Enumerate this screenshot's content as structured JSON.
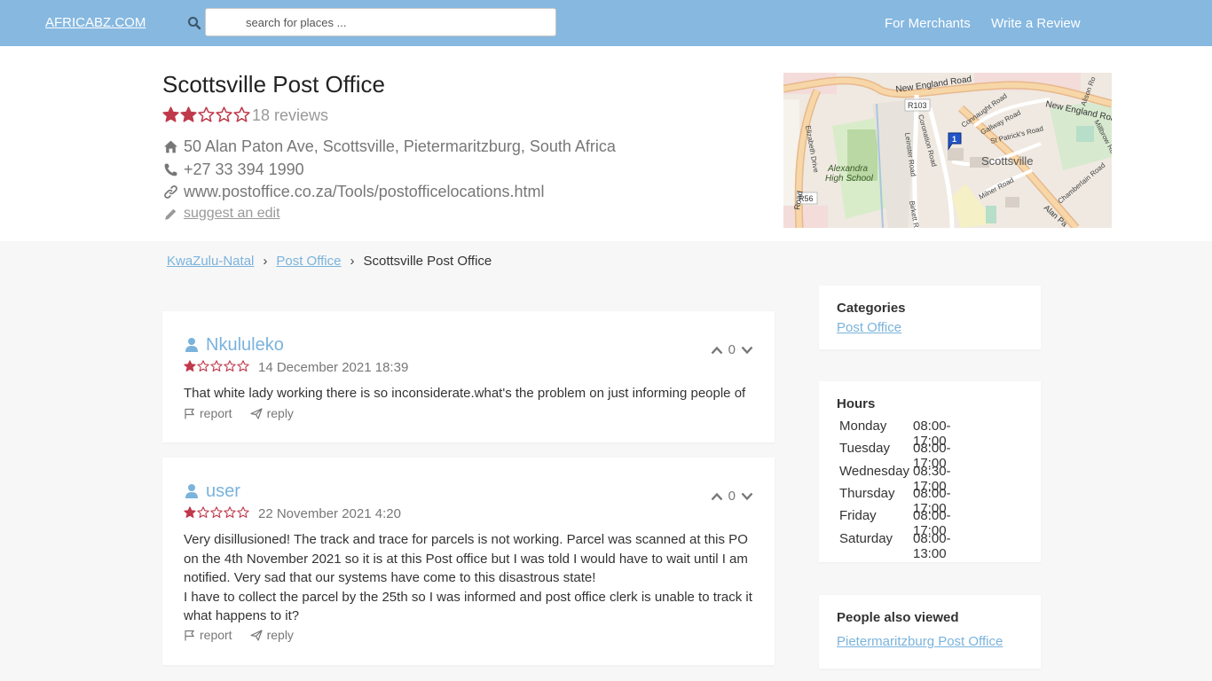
{
  "header": {
    "brand": "AFRICABZ.COM",
    "search_placeholder": "search for places ...",
    "nav": [
      "For Merchants",
      "Write a Review"
    ]
  },
  "place": {
    "name": "Scottsville Post Office",
    "rating": 2,
    "rating_max": 5,
    "reviews_label": "18 reviews",
    "address": "50 Alan Paton Ave, Scottsville, Pietermaritzburg, South Africa",
    "phone": "+27 33 394 1990",
    "website": "www.postoffice.co.za/Tools/postofficelocations.html",
    "suggest_edit": "suggest an edit"
  },
  "map": {
    "labels": {
      "new_england_1": "New England Road",
      "new_england_2": "New England Road",
      "r103": "R103",
      "r56": "R56",
      "connaught": "Connaught Road",
      "gallway": "Gallway Road",
      "st_patricks": "St Patrick's Road",
      "coronation": "Coronation Road",
      "leinster": "Leinster Road",
      "elizabeth": "Elizabeth Drive",
      "alexandra": "Alexandra",
      "high_school": "High School",
      "scottsville": "Scottsville",
      "milner": "Milner Road",
      "birkett": "Birkett Ro",
      "alan_pa": "Alan Pa",
      "chamberlain": "Chamberlain Road",
      "alison": "Alison Ro",
      "millbrow": "Millbrow Ro",
      "road": "Road",
      "marker": "1"
    }
  },
  "breadcrumb": {
    "items": [
      "KwaZulu-Natal",
      "Post Office"
    ],
    "current": "Scottsville Post Office"
  },
  "reviews": [
    {
      "user": "Nkululeko",
      "rating": 1,
      "date": "14 December 2021 18:39",
      "votes": "0",
      "lines": [
        "That white lady working there is so inconsiderate.what's the problem on just informing people of"
      ]
    },
    {
      "user": "user",
      "rating": 1,
      "date": "22 November 2021 4:20",
      "votes": "0",
      "lines": [
        "Very disillusioned! The track and trace for parcels is not working. Parcel was scanned at this PO",
        "on the 4th November 2021 so it is at this Post office but I was told I would have to wait until I am",
        "notified. Very sad that our systems have come to this disastrous state!",
        "I have to collect the parcel by the 25th so I was informed and post office clerk is unable to track it",
        "what happens to it?"
      ]
    }
  ],
  "review_actions": {
    "report": "report",
    "reply": "reply"
  },
  "sidebar": {
    "categories": {
      "title": "Categories",
      "items": [
        "Post Office"
      ]
    },
    "hours": {
      "title": "Hours",
      "rows": [
        {
          "day": "Monday",
          "time": "08:00-17:00"
        },
        {
          "day": "Tuesday",
          "time": "08:00-17:00"
        },
        {
          "day": "Wednesday",
          "time": "08:30-17:00"
        },
        {
          "day": "Thursday",
          "time": "08:00-17:00"
        },
        {
          "day": "Friday",
          "time": "08:00-17:00"
        },
        {
          "day": "Saturday",
          "time": "08:00-13:00"
        }
      ]
    },
    "also_viewed": {
      "title": "People also viewed",
      "items": [
        "Pietermaritzburg Post Office"
      ]
    }
  },
  "colors": {
    "header": "#86b8e0",
    "link": "#7ab3dc",
    "star": "#c0394b"
  },
  "icons": [
    "search-icon",
    "home-icon",
    "phone-icon",
    "link-icon",
    "pencil-icon",
    "user-icon",
    "chevron-up-icon",
    "chevron-down-icon",
    "flag-icon",
    "send-icon",
    "star-icon"
  ]
}
